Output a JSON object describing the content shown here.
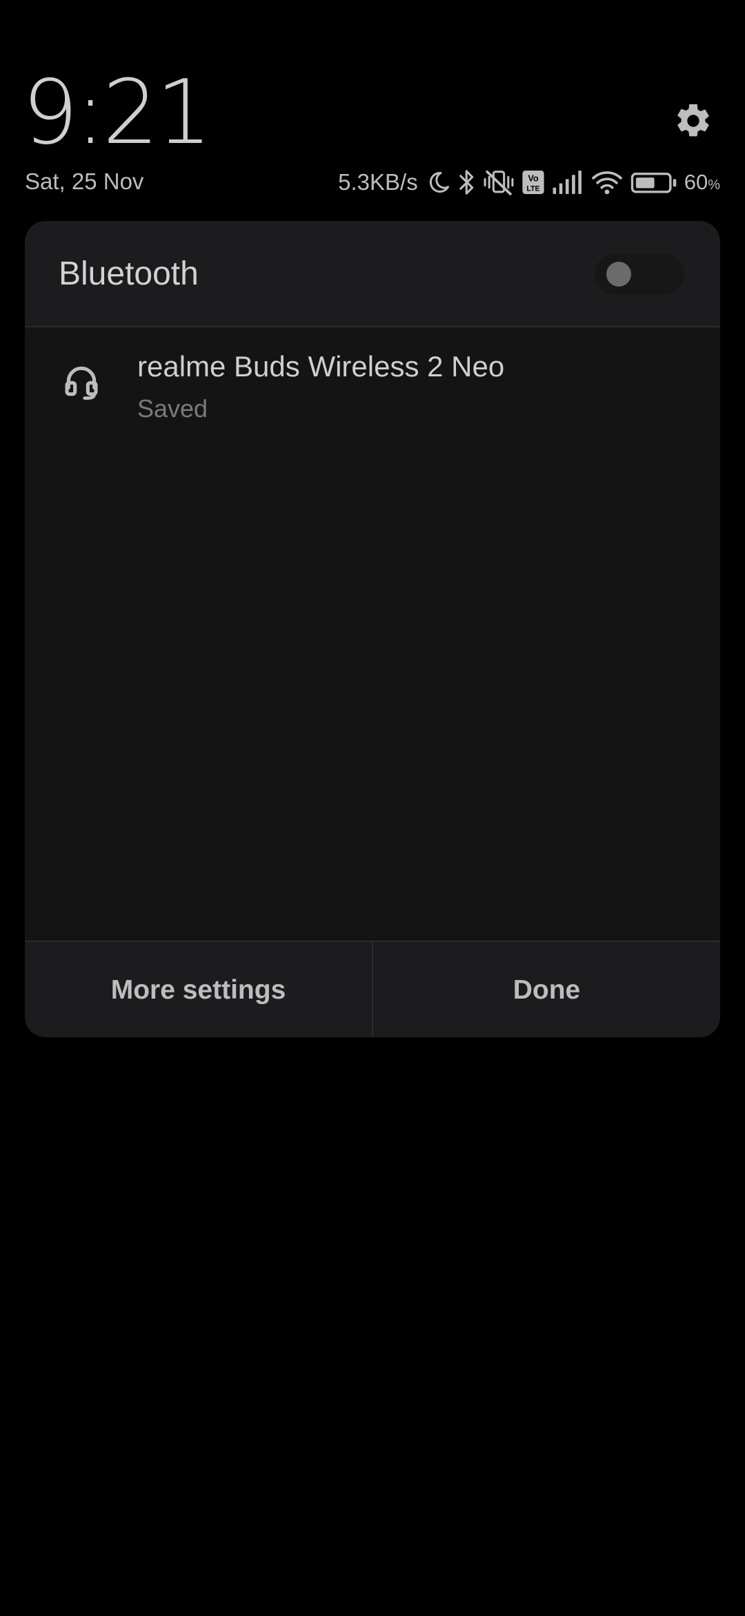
{
  "status_bar": {
    "time": "9:21",
    "date": "Sat, 25 Nov",
    "net_speed": "5.3KB/s",
    "battery_percent": "60",
    "battery_unit": "%",
    "icons": [
      "moon-icon",
      "bluetooth-icon",
      "vibrate-off-icon",
      "volte-icon",
      "signal-icon",
      "wifi-icon",
      "battery-icon"
    ],
    "volte_label_top": "Vo",
    "volte_label_bottom": "LTE",
    "battery_level": 0.6
  },
  "settings_icon": "gear-icon",
  "dialog": {
    "title": "Bluetooth",
    "toggle_on": false,
    "devices": [
      {
        "icon": "headset-icon",
        "name": "realme Buds Wireless 2 Neo",
        "status": "Saved"
      }
    ],
    "buttons": {
      "more_settings": "More settings",
      "done": "Done"
    }
  },
  "colors": {
    "background": "#000000",
    "dialog_body": "#141415",
    "dialog_header": "#1c1c1e",
    "text_primary": "#d2d2d2",
    "text_secondary": "#7a7a7a"
  }
}
